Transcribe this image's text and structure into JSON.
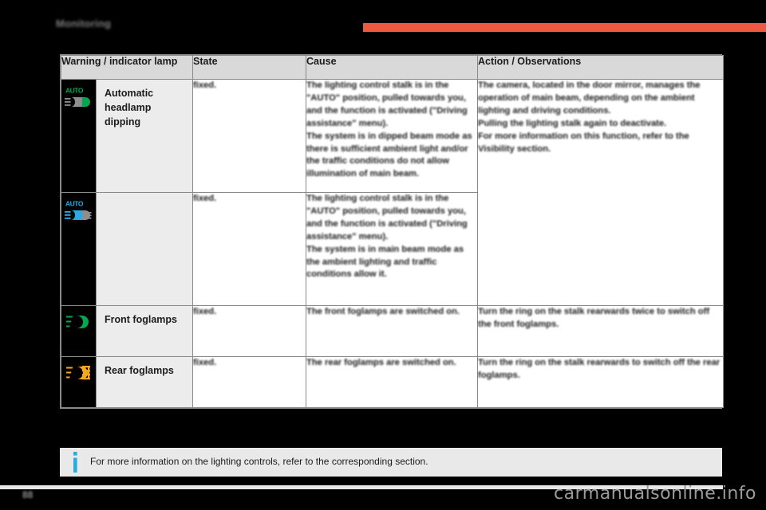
{
  "header": {
    "chapter_title": "Monitoring",
    "rule_color": "#ed5a3f"
  },
  "table": {
    "columns": [
      "Warning / indicator lamp",
      "State",
      "Cause",
      "Action / Observations"
    ],
    "rows": [
      {
        "icon_name": "auto-dipped-beam-green-icon",
        "icon_color": "#00a851",
        "lamp": "Automatic\nheadlamp\ndipping",
        "state": "fixed.",
        "cause": "The lighting control stalk is in the \"AUTO\" position, pulled towards you, and the function is activated (\"Driving assistance\" menu).\nThe system is in dipped beam mode as there is sufficient ambient light and/or the traffic conditions do not allow illumination of main beam.",
        "action": "The camera, located in the door mirror, manages the operation of main beam, depending on the ambient lighting and driving conditions.\nPulling the lighting stalk again to deactivate.\nFor more information on this function, refer to the Visibility section."
      },
      {
        "icon_name": "auto-main-beam-blue-icon",
        "icon_color": "#29abe2",
        "lamp": "",
        "state": "fixed.",
        "cause": "The lighting control stalk is in the \"AUTO\" position, pulled towards you, and the function is activated (\"Driving assistance\" menu).\nThe system is in main beam mode as the ambient lighting and traffic conditions allow it.",
        "action": ""
      },
      {
        "icon_name": "front-foglamp-green-icon",
        "icon_color": "#00a851",
        "lamp": "Front foglamps",
        "state": "fixed.",
        "cause": "The front foglamps are switched on.",
        "action": "Turn the ring on the stalk rearwards twice to switch off the front foglamps."
      },
      {
        "icon_name": "rear-foglamp-amber-icon",
        "icon_color": "#f5a623",
        "lamp": "Rear foglamps",
        "state": "fixed.",
        "cause": "The rear foglamps are switched on.",
        "action": "Turn the ring on the stalk rearwards to switch off the rear foglamps."
      }
    ]
  },
  "note": {
    "icon_name": "information-icon",
    "icon_color": "#29abe2",
    "text": "For more information on the lighting controls, refer to the corresponding section."
  },
  "footer": {
    "page_number": "88",
    "watermark": "carmanualsonline.info"
  }
}
